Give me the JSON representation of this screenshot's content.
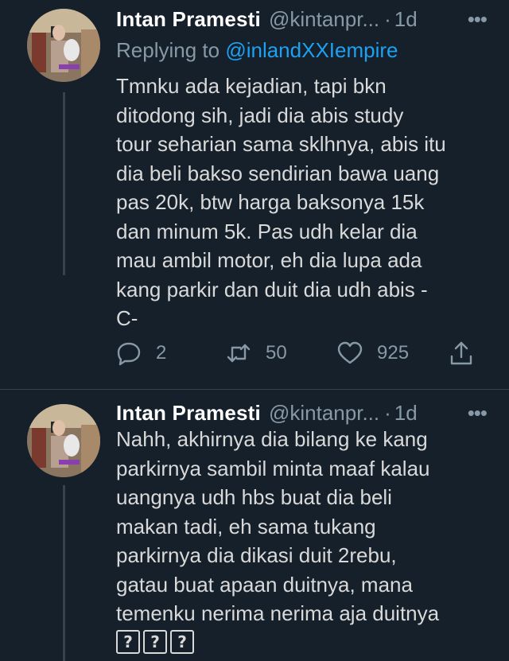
{
  "tweets": [
    {
      "name": "Intan Pramesti",
      "handle": "@kintanpr...",
      "dot": "·",
      "time": "1d",
      "reply_prefix": "Replying to ",
      "reply_mention": "@inlandXXIempire",
      "text": "Tmnku ada kejadian, tapi bkn\nditodong sih, jadi dia abis study\ntour seharian sama sklhnya, abis itu\ndia beli bakso sendirian bawa uang\npas 20k, btw harga baksonya 15k\ndan minum 5k. Pas udh kelar dia\nmau ambil motor, eh dia lupa ada\nkang parkir dan duit dia udh abis -\nC-",
      "replies": "2",
      "retweets": "50",
      "likes": "925"
    },
    {
      "name": "Intan Pramesti",
      "handle": "@kintanpr...",
      "dot": "·",
      "time": "1d",
      "text": "Nahh, akhirnya dia bilang ke kang\nparkirnya sambil minta maaf kalau\nuangnya udh hbs buat dia beli\nmakan tadi, eh sama tukang\nparkirnya dia dikasi duit 2rebu,\ngatau buat apaan duitnya, mana\ntemenku nerima nerima aja duitnya",
      "emojis": [
        "?",
        "?",
        "?"
      ]
    }
  ],
  "colors": {
    "background": "#15202b",
    "text": "#d9d9d9",
    "secondary": "#8899a6",
    "accent": "#1da1f2"
  },
  "icons": [
    "more-icon",
    "reply-icon",
    "retweet-icon",
    "like-icon",
    "share-icon"
  ]
}
